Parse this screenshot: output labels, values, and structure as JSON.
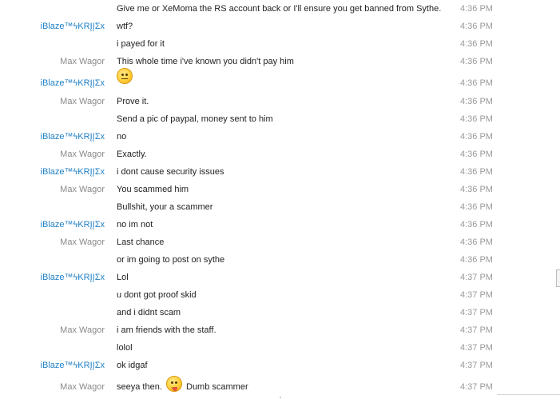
{
  "colors": {
    "self_sender": "#1e7fc6",
    "other_sender": "#8a8a8a",
    "message_text": "#222222",
    "timestamp": "#9a9a9a"
  },
  "messages": [
    {
      "sender": "",
      "text": "Give me or XeMoma the RS account back or I'll ensure you get banned from Sythe.",
      "time": "4:36 PM"
    },
    {
      "sender": "iBlaze™ϟKRĮĮΣx",
      "text": "wtf?",
      "time": "4:36 PM"
    },
    {
      "sender": "",
      "text": "i payed for it",
      "time": "4:36 PM"
    },
    {
      "sender": "Max Wagor",
      "text": "This whole time i've known you didn't pay him",
      "time": "4:36 PM"
    },
    {
      "sender": "iBlaze™ϟKRĮĮΣx",
      "text": "",
      "emoji": "straight-face-emoji",
      "time": "4:36 PM"
    },
    {
      "sender": "Max Wagor",
      "text": "Prove it.",
      "time": "4:36 PM"
    },
    {
      "sender": "",
      "text": "Send a pic of paypal, money sent to him",
      "time": "4:36 PM"
    },
    {
      "sender": "iBlaze™ϟKRĮĮΣx",
      "text": "no",
      "time": "4:36 PM"
    },
    {
      "sender": "Max Wagor",
      "text": "Exactly.",
      "time": "4:36 PM"
    },
    {
      "sender": "iBlaze™ϟKRĮĮΣx",
      "text": "i dont cause security issues",
      "time": "4:36 PM"
    },
    {
      "sender": "Max Wagor",
      "text": "You scammed him",
      "time": "4:36 PM"
    },
    {
      "sender": "",
      "text": "Bullshit, your a scammer",
      "time": "4:36 PM"
    },
    {
      "sender": "iBlaze™ϟKRĮĮΣx",
      "text": "no im not",
      "time": "4:36 PM"
    },
    {
      "sender": "Max Wagor",
      "text": "Last chance",
      "time": "4:36 PM"
    },
    {
      "sender": "",
      "text": "or im going to post on sythe",
      "time": "4:36 PM"
    },
    {
      "sender": "iBlaze™ϟKRĮĮΣx",
      "text": "Lol",
      "time": "4:37 PM"
    },
    {
      "sender": "",
      "text": "u dont got proof skid",
      "time": "4:37 PM"
    },
    {
      "sender": "",
      "text": "and i didnt scam",
      "time": "4:37 PM"
    },
    {
      "sender": "Max Wagor",
      "text": "i am friends with the staff.",
      "time": "4:37 PM"
    },
    {
      "sender": "",
      "text": "lolol",
      "time": "4:37 PM"
    },
    {
      "sender": "iBlaze™ϟKRĮĮΣx",
      "text": "ok idgaf",
      "time": "4:37 PM"
    },
    {
      "sender": "Max Wagor",
      "text": "seeya then.",
      "emoji": "tongue-out-emoji",
      "text_after": "Dumb scammer",
      "time": "4:37 PM"
    }
  ]
}
